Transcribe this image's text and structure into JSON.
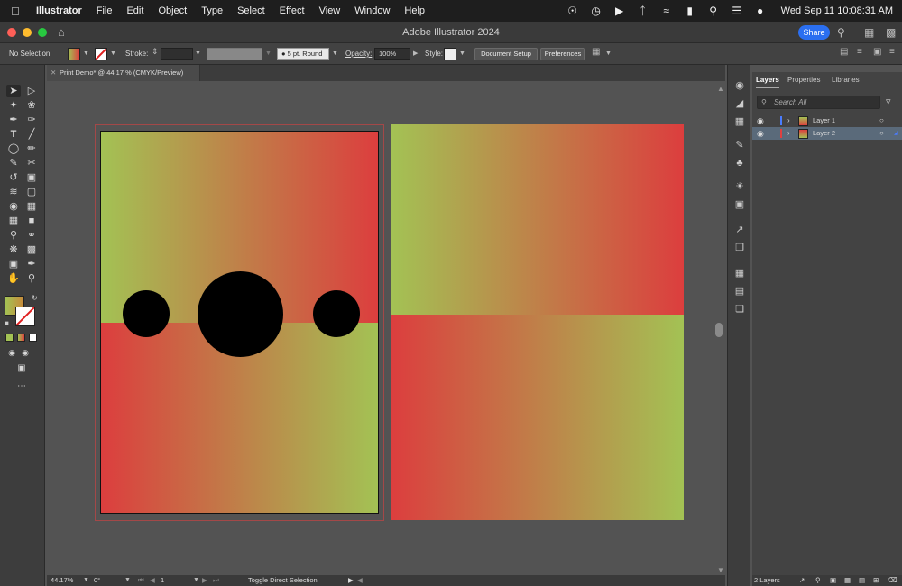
{
  "menubar": {
    "app_name": "Illustrator",
    "items": [
      "File",
      "Edit",
      "Object",
      "Type",
      "Select",
      "Effect",
      "View",
      "Window",
      "Help"
    ],
    "clock": "Wed Sep 11  10:08:31 AM"
  },
  "titlebar": {
    "title": "Adobe Illustrator 2024",
    "share_label": "Share"
  },
  "controlbar": {
    "selection_label": "No Selection",
    "stroke_label": "Stroke:",
    "brush_value": "5 pt. Round",
    "opacity_label": "Opacity:",
    "opacity_value": "100%",
    "style_label": "Style:",
    "document_setup_label": "Document Setup",
    "preferences_label": "Preferences"
  },
  "document": {
    "tab_title": "Print Demo* @ 44.17 % (CMYK/Preview)"
  },
  "colors": {
    "gradient_green": "#a3c254",
    "gradient_red": "#dc3e3e",
    "artboard_border": "#b03030",
    "selection_blue": "#5a6a7a",
    "layer1_color": "#4a7cff",
    "layer2_color": "#e04040"
  },
  "layers_panel": {
    "tabs": [
      "Layers",
      "Properties",
      "Libraries"
    ],
    "search_placeholder": "Search All",
    "layers": [
      {
        "name": "Layer 1",
        "selected": false
      },
      {
        "name": "Layer 2",
        "selected": true
      }
    ],
    "footer_count": "2 Layers"
  },
  "statusbar": {
    "zoom": "44.17%",
    "rotation": "0°",
    "artboard_number": "1",
    "status_text": "Toggle Direct Selection"
  }
}
